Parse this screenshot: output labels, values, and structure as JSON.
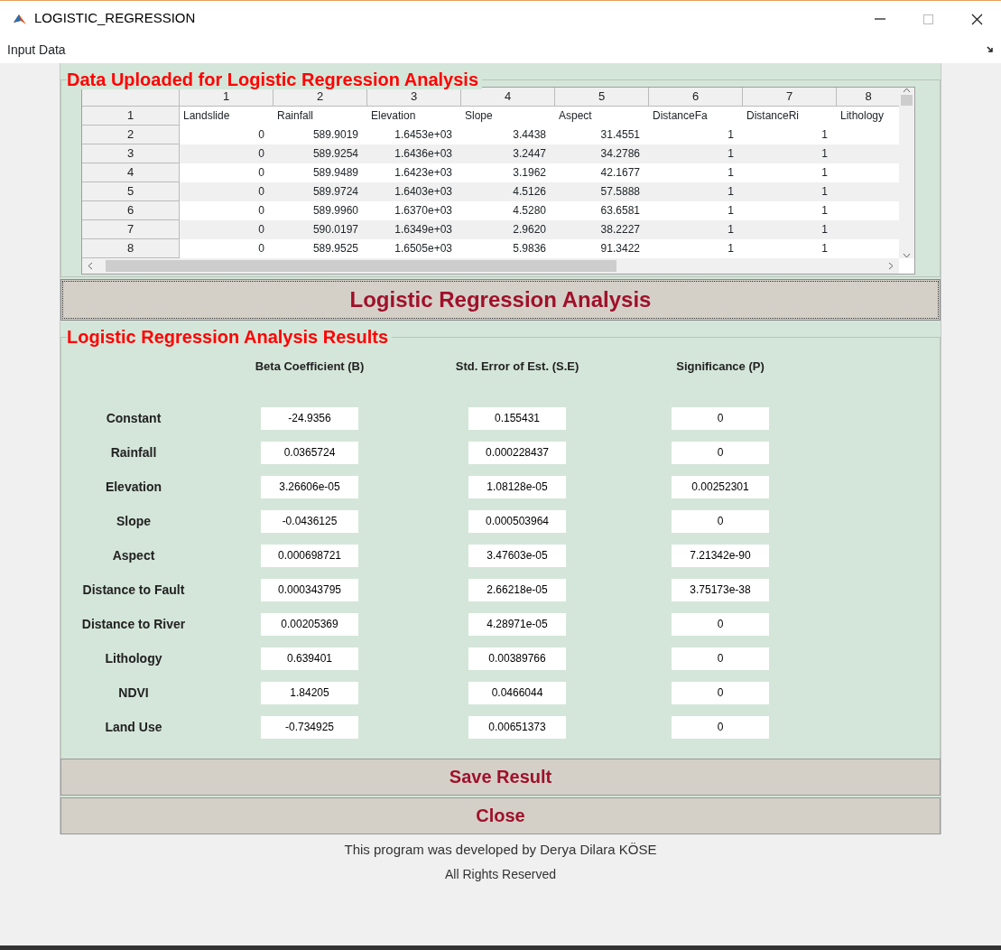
{
  "window": {
    "title": "LOGISTIC_REGRESSION"
  },
  "menu": [
    "Input Data"
  ],
  "data_panel": {
    "title": "Data Uploaded for Logistic Regression Analysis",
    "table": {
      "columns": [
        "1",
        "2",
        "3",
        "4",
        "5",
        "6",
        "7",
        "8"
      ],
      "rows": [
        {
          "header": "1",
          "kind": "labels",
          "cells": [
            "Landslide",
            "Rainfall",
            "Elevation",
            "Slope",
            "Aspect",
            "DistanceFa",
            "DistanceRi",
            "Lithology"
          ]
        },
        {
          "header": "2",
          "kind": "numbers",
          "cells": [
            "0",
            "589.9019",
            "1.6453e+03",
            "3.4438",
            "31.4551",
            "1",
            "1",
            ""
          ]
        },
        {
          "header": "3",
          "kind": "numbers",
          "cells": [
            "0",
            "589.9254",
            "1.6436e+03",
            "3.2447",
            "34.2786",
            "1",
            "1",
            ""
          ]
        },
        {
          "header": "4",
          "kind": "numbers",
          "cells": [
            "0",
            "589.9489",
            "1.6423e+03",
            "3.1962",
            "42.1677",
            "1",
            "1",
            ""
          ]
        },
        {
          "header": "5",
          "kind": "numbers",
          "cells": [
            "0",
            "589.9724",
            "1.6403e+03",
            "4.5126",
            "57.5888",
            "1",
            "1",
            ""
          ]
        },
        {
          "header": "6",
          "kind": "numbers",
          "cells": [
            "0",
            "589.9960",
            "1.6370e+03",
            "4.5280",
            "63.6581",
            "1",
            "1",
            ""
          ]
        },
        {
          "header": "7",
          "kind": "numbers",
          "cells": [
            "0",
            "590.0197",
            "1.6349e+03",
            "2.9620",
            "38.2227",
            "1",
            "1",
            ""
          ]
        },
        {
          "header": "8",
          "kind": "numbers",
          "cells": [
            "0",
            "589.9525",
            "1.6505e+03",
            "5.9836",
            "91.3422",
            "1",
            "1",
            ""
          ]
        }
      ]
    }
  },
  "analyze_button": "Logistic Regression Analysis",
  "results_panel": {
    "title": "Logistic Regression Analysis Results",
    "columns": [
      "Beta Coefficient (B)",
      "Std. Error of Est. (S.E)",
      "Significance (P)"
    ],
    "rows": [
      {
        "label": "Constant",
        "values": [
          "-24.9356",
          "0.155431",
          "0"
        ]
      },
      {
        "label": "Rainfall",
        "values": [
          "0.0365724",
          "0.000228437",
          "0"
        ]
      },
      {
        "label": "Elevation",
        "values": [
          "3.26606e-05",
          "1.08128e-05",
          "0.00252301"
        ]
      },
      {
        "label": "Slope",
        "values": [
          "-0.0436125",
          "0.000503964",
          "0"
        ]
      },
      {
        "label": "Aspect",
        "values": [
          "0.000698721",
          "3.47603e-05",
          "7.21342e-90"
        ]
      },
      {
        "label": "Distance to Fault",
        "values": [
          "0.000343795",
          "2.66218e-05",
          "3.75173e-38"
        ]
      },
      {
        "label": "Distance to River",
        "values": [
          "0.00205369",
          "4.28971e-05",
          "0"
        ]
      },
      {
        "label": "Lithology",
        "values": [
          "0.639401",
          "0.00389766",
          "0"
        ]
      },
      {
        "label": "NDVI",
        "values": [
          "1.84205",
          "0.0466044",
          "0"
        ]
      },
      {
        "label": "Land Use",
        "values": [
          "-0.734925",
          "0.00651373",
          "0"
        ]
      }
    ]
  },
  "buttons": [
    "Save Result",
    "Close"
  ],
  "footer": [
    "This program was developed by Derya Dilara KÖSE",
    "All Rights Reserved"
  ]
}
